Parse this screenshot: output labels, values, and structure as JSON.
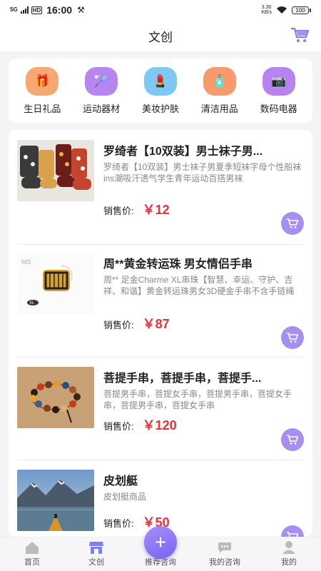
{
  "status_bar": {
    "signal": "5G",
    "hd": "HD",
    "time": "16:00",
    "speed_value": "3.30",
    "speed_unit": "KB/s",
    "battery": "100"
  },
  "header": {
    "title": "文创"
  },
  "categories": [
    {
      "label": "生日礼品",
      "icon": "gift-icon",
      "color": "#f7a872"
    },
    {
      "label": "运动器材",
      "icon": "badminton-icon",
      "color": "#b884f0"
    },
    {
      "label": "美妆护肤",
      "icon": "cosmetics-icon",
      "color": "#7ec8f2"
    },
    {
      "label": "清洁用品",
      "icon": "spray-bottle-icon",
      "color": "#f79a6c"
    },
    {
      "label": "数码电器",
      "icon": "camera-icon",
      "color": "#b882f0"
    }
  ],
  "products": [
    {
      "title": "罗绮者【10双装】男士袜子男...",
      "desc": "罗绮者【10双装】男士袜子男夏季短袜字母个性船袜ins潮吸汗透气学生青年运动百搭男袜",
      "price_label": "销售价:",
      "price": "￥12"
    },
    {
      "title": "周**黄金转运珠 男女情侣手串",
      "desc": "周** 足金Charme XL串珠【智慧、幸运、守护、吉祥、和谐】黄金转运珠男女3D硬金手串不含手链绳",
      "price_label": "销售价:",
      "price": "￥87"
    },
    {
      "title": "菩提手串，菩提手串，菩提手...",
      "desc": "菩提男手串，菩提女手串，菩提男手串，菩提女手串，菩提男手串，菩提女手串",
      "price_label": "销售价:",
      "price": "￥120"
    },
    {
      "title": "皮划艇",
      "desc": "皮划艇商品",
      "price_label": "销售价:",
      "price": "￥50"
    }
  ],
  "tabbar": {
    "items": [
      {
        "label": "首页"
      },
      {
        "label": "文创"
      },
      {
        "label": "推荐咨询"
      },
      {
        "label": "我的咨询"
      },
      {
        "label": "我的"
      }
    ],
    "active_index": 1
  },
  "colors": {
    "accent": "#a58ff0",
    "price": "#e8303a"
  }
}
